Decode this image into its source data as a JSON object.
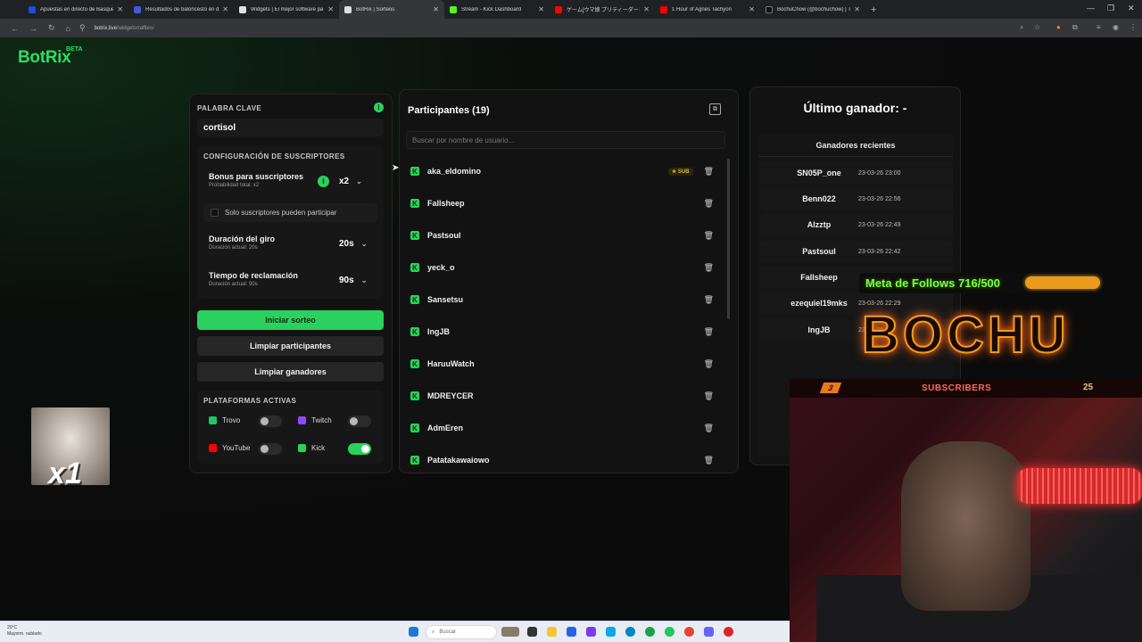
{
  "browser": {
    "tabs": [
      {
        "title": "Apuestas en directo de Basque",
        "color": "#1d4ed8"
      },
      {
        "title": "Resultados de baloncesto en di",
        "color": "#3b5bdb"
      },
      {
        "title": "Widgets | El mejor software pa",
        "color": "#e0e0e0"
      },
      {
        "title": "BotRix | Sorteos",
        "color": "#e0e0e0"
      },
      {
        "title": "Stream - Kick Dashboard",
        "color": "#53fc18"
      },
      {
        "title": "ゲーム[ウマ娘 プリティーダービー]ライ",
        "color": "#ff0000"
      },
      {
        "title": "1 Hour of Agnes Tachyon",
        "color": "#ff0000"
      },
      {
        "title": "BochuChow (@bochuchow) | Ti",
        "color": "#111111"
      }
    ],
    "url_domain": "botrix.live",
    "url_path": "/widgets/raffles/"
  },
  "app": {
    "logo": "BotRix",
    "beta": "BETA"
  },
  "settings": {
    "keyword_label": "PALABRA CLAVE",
    "keyword_value": "cortisol",
    "subs_section": "CONFIGURACIÓN DE SUSCRIPTORES",
    "bonus_title": "Bonus para suscriptores",
    "bonus_sub": "Probabilidad total: x2",
    "bonus_value": "x2",
    "only_subs": "Solo suscriptores pueden participar",
    "spin_title": "Duración del giro",
    "spin_sub": "Duración actual: 20s",
    "spin_value": "20s",
    "claim_title": "Tiempo de reclamación",
    "claim_sub": "Duración actual: 90s",
    "claim_value": "90s",
    "start_btn": "Iniciar sorteo",
    "clear_participants_btn": "Limpiar participantes",
    "clear_winners_btn": "Limpiar ganadores",
    "platforms_label": "PLATAFORMAS ACTIVAS",
    "platforms": [
      {
        "name": "Trovo",
        "enabled": false,
        "color": "#1ec76a"
      },
      {
        "name": "Twitch",
        "enabled": false,
        "color": "#9146ff"
      },
      {
        "name": "YouTube",
        "enabled": false,
        "color": "#ff0000"
      },
      {
        "name": "Kick",
        "enabled": true,
        "color": "#2bd15e"
      }
    ]
  },
  "participants": {
    "title": "Participantes (19)",
    "search_placeholder": "Buscar por nombre de usuario...",
    "sub_badge": "SUB",
    "list": [
      {
        "name": "aka_eldomino",
        "sub": true
      },
      {
        "name": "Fallsheep",
        "sub": false
      },
      {
        "name": "Pastsoul",
        "sub": false
      },
      {
        "name": "yeck_o",
        "sub": false
      },
      {
        "name": "Sansetsu",
        "sub": false
      },
      {
        "name": "IngJB",
        "sub": false
      },
      {
        "name": "HaruuWatch",
        "sub": false
      },
      {
        "name": "MDREYCER",
        "sub": false
      },
      {
        "name": "AdmEren",
        "sub": false
      },
      {
        "name": "Patatakawaiowo",
        "sub": false
      }
    ]
  },
  "winners": {
    "last_winner": "Último ganador: -",
    "recent_title": "Ganadores recientes",
    "list": [
      {
        "name": "SN05P_one",
        "date": "23-03-26 23:00"
      },
      {
        "name": "Benn022",
        "date": "23-03-26 22:56"
      },
      {
        "name": "Alzztp",
        "date": "23-03-26 22:49"
      },
      {
        "name": "Pastsoul",
        "date": "23-03-26 22:42"
      },
      {
        "name": "Fallsheep",
        "date": ""
      },
      {
        "name": "ezequiel19mks",
        "date": "23-03-26 22:29"
      },
      {
        "name": "IngJB",
        "date": "23-03-26 22"
      }
    ]
  },
  "overlay": {
    "follows_goal": "Meta de Follows 716/500",
    "follows_progress": 1.0,
    "brand": "BOCHU",
    "cam_left_count": "3",
    "cam_label": "SUBSCRIBERS",
    "cam_right_count": "25",
    "multiplier": "x1"
  },
  "taskbar": {
    "temp": "20°C",
    "weather": "Mayorm. nublado",
    "search": "Buscar"
  }
}
